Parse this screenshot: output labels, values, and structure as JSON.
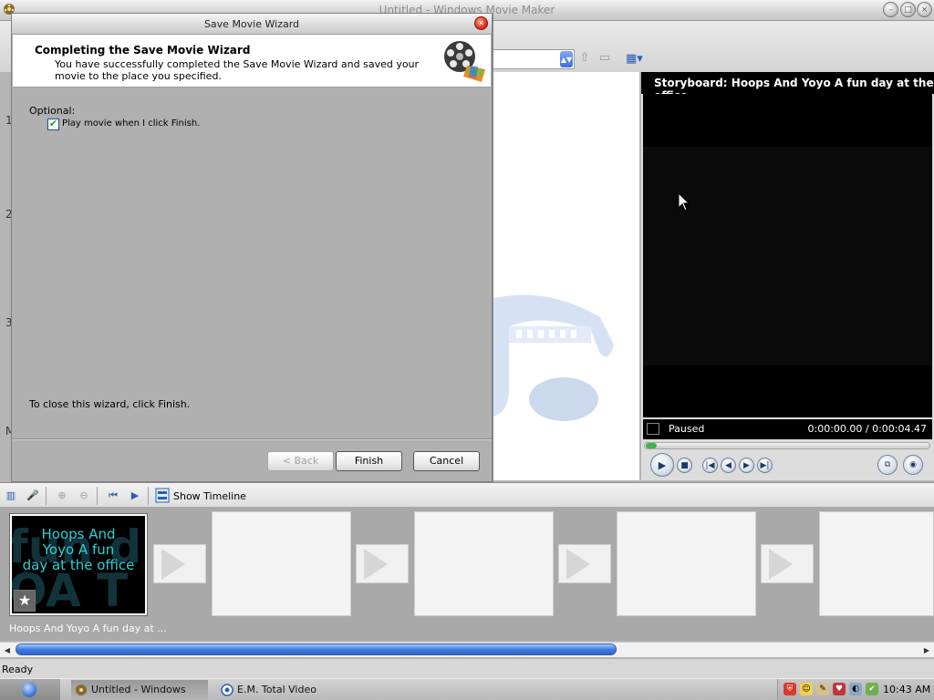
{
  "app": {
    "title": "Untitled - Windows Movie Maker"
  },
  "dialog": {
    "title": "Save Movie Wizard",
    "heading": "Completing the Save Movie Wizard",
    "subtitle": "You have successfully completed the Save Movie Wizard and saved your movie to the place you specified.",
    "optional_label": "Optional:",
    "play_checkbox_label": "Play movie when I click Finish.",
    "play_checked": true,
    "close_hint": "To close this wizard, click Finish.",
    "back_label": "< Back",
    "finish_label": "Finish",
    "cancel_label": "Cancel"
  },
  "left_markers": [
    "1",
    "2",
    "3",
    "M"
  ],
  "monitor": {
    "title": "Storyboard: Hoops And Yoyo A fun day at the office",
    "status": "Paused",
    "time": "0:00:00.00 / 0:00:04.47"
  },
  "storyboard_toolbar": {
    "show_timeline_label": "Show Timeline"
  },
  "storyboard": {
    "clip_title_text": "Hoops And Yoyo A fun day at the office",
    "clip_bg_text": "fun d OA T",
    "clip_caption": "Hoops And Yoyo A fun day at ..."
  },
  "statusbar": {
    "text": "Ready"
  },
  "taskbar": {
    "task1": "Untitled - Windows Mo...",
    "task2": "E.M. Total Video Conve...",
    "clock": "10:43 AM"
  },
  "colors": {
    "accent_blue": "#3c7de0",
    "clip_text": "#2ad2d8",
    "close_red": "#e0331c"
  }
}
